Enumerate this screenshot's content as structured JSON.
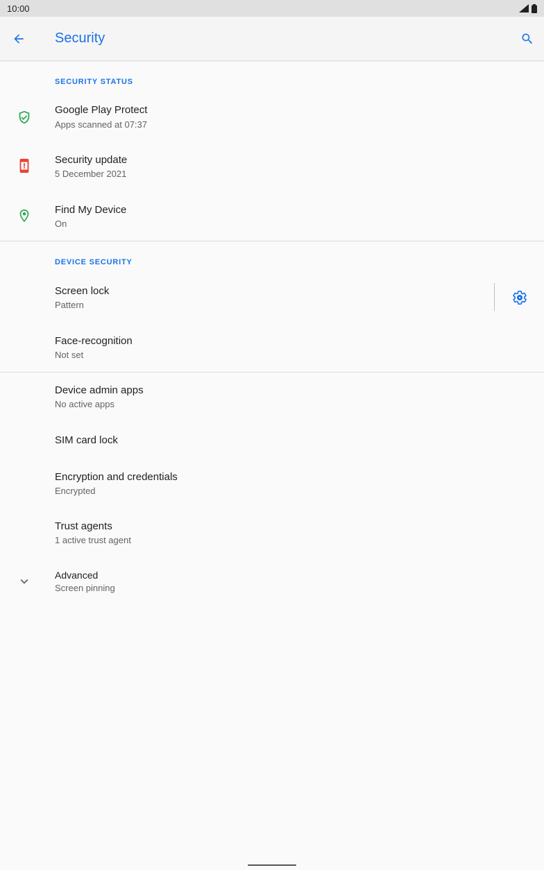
{
  "status_bar": {
    "time": "10:00"
  },
  "app_bar": {
    "title": "Security"
  },
  "sections": {
    "security_status": "SECURITY STATUS",
    "device_security": "DEVICE SECURITY"
  },
  "items": {
    "play_protect": {
      "title": "Google Play Protect",
      "subtitle": "Apps scanned at 07:37"
    },
    "security_update": {
      "title": "Security update",
      "subtitle": "5 December 2021"
    },
    "find_device": {
      "title": "Find My Device",
      "subtitle": "On"
    },
    "screen_lock": {
      "title": "Screen lock",
      "subtitle": "Pattern"
    },
    "face_recognition": {
      "title": "Face-recognition",
      "subtitle": "Not set"
    },
    "device_admin": {
      "title": "Device admin apps",
      "subtitle": "No active apps"
    },
    "sim_lock": {
      "title": "SIM card lock"
    },
    "encryption": {
      "title": "Encryption and credentials",
      "subtitle": "Encrypted"
    },
    "trust_agents": {
      "title": "Trust agents",
      "subtitle": "1 active trust agent"
    },
    "advanced": {
      "title": "Advanced",
      "subtitle": "Screen pinning"
    }
  },
  "colors": {
    "accent": "#1a73e8",
    "ok_green": "#34a853",
    "warning_red": "#ea4335"
  },
  "icons": {
    "back": "arrow-back-icon",
    "search": "search-icon",
    "play_protect": "shield-check-icon",
    "security_update": "phone-alert-icon",
    "find_device": "location-pin-icon",
    "screen_lock_settings": "gear-icon",
    "advanced": "chevron-down-icon"
  }
}
